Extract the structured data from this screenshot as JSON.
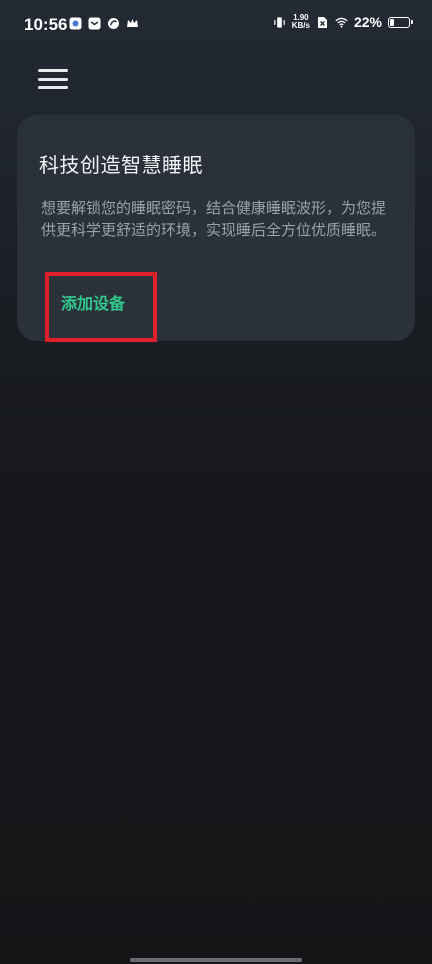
{
  "status_bar": {
    "time": "10:56",
    "net_speed_value": "1.90",
    "net_speed_unit": "KB/s",
    "battery": "22%",
    "battery_level": 0.22,
    "icons": [
      "app-notification-icon",
      "mail-notification-icon",
      "swirl-app-icon",
      "crown-app-icon",
      "vibrate-icon",
      "no-sim-icon",
      "wifi-icon",
      "battery-icon"
    ]
  },
  "header": {
    "menu_icon": "hamburger-menu-icon"
  },
  "card": {
    "title": "科技创造智慧睡眠",
    "description": "想要解锁您的睡眠密码，结合健康睡眠波形，为您提供更科学更舒适的环境，实现睡后全方位优质睡眠。",
    "add_device_label": "添加设备"
  },
  "colors": {
    "accent": "#31c98e",
    "highlight": "#e0202a",
    "card_bg": "#2a313b"
  }
}
